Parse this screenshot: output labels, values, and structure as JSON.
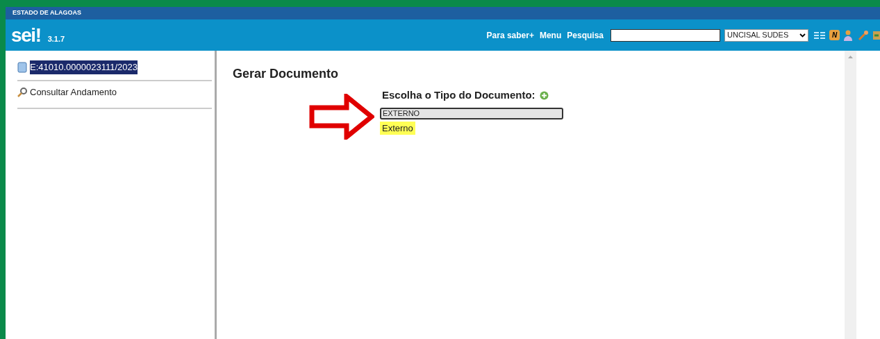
{
  "banner": {
    "title": "ESTADO DE ALAGOAS"
  },
  "header": {
    "logo": "sei!",
    "version": "3.1.7",
    "links": [
      "Para saber+",
      "Menu",
      "Pesquisa"
    ],
    "unit_select": {
      "value": "UNCISAL SUDES"
    },
    "badge": "N"
  },
  "sidebar": {
    "items": [
      {
        "kind": "process",
        "label": "E:41010.0000023111/2023",
        "selected": true
      },
      {
        "kind": "link",
        "label": "Consultar Andamento",
        "selected": false
      }
    ]
  },
  "main": {
    "title": "Gerar Documento",
    "prompt": "Escolha o Tipo do Documento:",
    "filter": {
      "value": "EXTERNO"
    },
    "options": [
      {
        "label": "Externo",
        "selected": true
      }
    ]
  }
}
